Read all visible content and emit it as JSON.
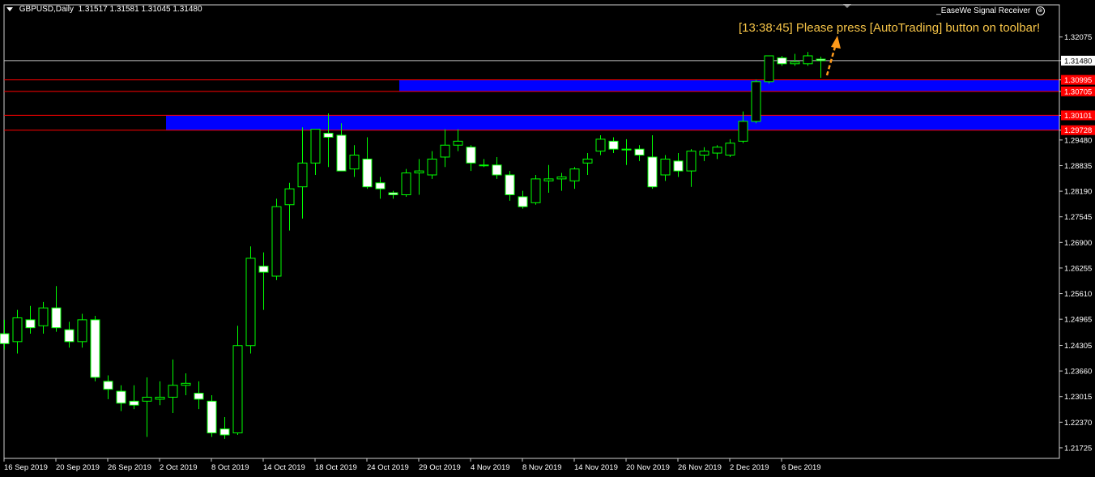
{
  "header": {
    "symbol_label": "GBPUSD,Daily",
    "ohlc_label": "1.31517 1.31581 1.31045 1.31480"
  },
  "indicator": {
    "name": "_EaseWe Signal Receiver",
    "icon": "settings-circle-icon"
  },
  "message": {
    "text": "[13:38:45] Please press [AutoTrading] button on toolbar!"
  },
  "colors": {
    "background": "#000000",
    "candle_border": "#00ff00",
    "bull_body": "#000000",
    "bear_body": "#ffffff",
    "zone_fill": "#0000ff",
    "zone_line": "#ff0000",
    "price_label_red": "#ff0000",
    "bid_line": "#c0c0c0",
    "message": "#f7c548",
    "arrow": "#ff9a1a",
    "axis_text": "#ffffff"
  },
  "chart_data": {
    "type": "candlestick",
    "symbol": "GBPUSD",
    "timeframe": "Daily",
    "ylim": [
      1.2153,
      1.32487
    ],
    "price_ticks": [
      "1.32075",
      "1.31480",
      "1.30995",
      "1.30705",
      "1.30101",
      "1.29728",
      "1.29480",
      "1.28835",
      "1.28190",
      "1.27545",
      "1.26900",
      "1.26255",
      "1.25610",
      "1.24965",
      "1.24305",
      "1.23660",
      "1.23015",
      "1.22370",
      "1.21725"
    ],
    "highlighted_prices": [
      {
        "label": "1.31480",
        "value": 1.3148,
        "style": "current"
      },
      {
        "label": "1.30995",
        "value": 1.30995,
        "style": "red"
      },
      {
        "label": "1.30705",
        "value": 1.30705,
        "style": "red"
      },
      {
        "label": "1.30101",
        "value": 1.30101,
        "style": "red"
      },
      {
        "label": "1.29728",
        "value": 1.29728,
        "style": "red"
      }
    ],
    "x_labels": [
      {
        "label": "16 Sep 2019",
        "index": 0
      },
      {
        "label": "20 Sep 2019",
        "index": 4
      },
      {
        "label": "26 Sep 2019",
        "index": 8
      },
      {
        "label": "2 Oct 2019",
        "index": 12
      },
      {
        "label": "8 Oct 2019",
        "index": 16
      },
      {
        "label": "14 Oct 2019",
        "index": 20
      },
      {
        "label": "18 Oct 2019",
        "index": 24
      },
      {
        "label": "24 Oct 2019",
        "index": 28
      },
      {
        "label": "29 Oct 2019",
        "index": 32
      },
      {
        "label": "4 Nov 2019",
        "index": 36
      },
      {
        "label": "8 Nov 2019",
        "index": 40
      },
      {
        "label": "14 Nov 2019",
        "index": 44
      },
      {
        "label": "20 Nov 2019",
        "index": 48
      },
      {
        "label": "26 Nov 2019",
        "index": 52
      },
      {
        "label": "2 Dec 2019",
        "index": 56
      },
      {
        "label": "6 Dec 2019",
        "index": 60
      }
    ],
    "zones": [
      {
        "top": 1.30995,
        "bottom": 1.30705,
        "start_index": 31
      },
      {
        "top": 1.30101,
        "bottom": 1.29728,
        "start_index": 13
      }
    ],
    "candles": [
      {
        "o": 1.246,
        "h": 1.2495,
        "l": 1.242,
        "c": 1.2435
      },
      {
        "o": 1.244,
        "h": 1.252,
        "l": 1.241,
        "c": 1.25
      },
      {
        "o": 1.2495,
        "h": 1.253,
        "l": 1.246,
        "c": 1.2475
      },
      {
        "o": 1.248,
        "h": 1.254,
        "l": 1.246,
        "c": 1.2525
      },
      {
        "o": 1.2525,
        "h": 1.258,
        "l": 1.2465,
        "c": 1.2475
      },
      {
        "o": 1.247,
        "h": 1.249,
        "l": 1.2425,
        "c": 1.244
      },
      {
        "o": 1.244,
        "h": 1.251,
        "l": 1.2425,
        "c": 1.2495
      },
      {
        "o": 1.2495,
        "h": 1.2505,
        "l": 1.234,
        "c": 1.235
      },
      {
        "o": 1.234,
        "h": 1.2355,
        "l": 1.2295,
        "c": 1.232
      },
      {
        "o": 1.2315,
        "h": 1.233,
        "l": 1.2265,
        "c": 1.2285
      },
      {
        "o": 1.229,
        "h": 1.233,
        "l": 1.227,
        "c": 1.228
      },
      {
        "o": 1.229,
        "h": 1.235,
        "l": 1.22,
        "c": 1.23
      },
      {
        "o": 1.2295,
        "h": 1.234,
        "l": 1.228,
        "c": 1.23
      },
      {
        "o": 1.23,
        "h": 1.2395,
        "l": 1.226,
        "c": 1.233
      },
      {
        "o": 1.233,
        "h": 1.236,
        "l": 1.2305,
        "c": 1.2335
      },
      {
        "o": 1.231,
        "h": 1.234,
        "l": 1.227,
        "c": 1.2295
      },
      {
        "o": 1.229,
        "h": 1.2305,
        "l": 1.22,
        "c": 1.221
      },
      {
        "o": 1.222,
        "h": 1.225,
        "l": 1.2195,
        "c": 1.2205
      },
      {
        "o": 1.221,
        "h": 1.248,
        "l": 1.2205,
        "c": 1.243
      },
      {
        "o": 1.243,
        "h": 1.268,
        "l": 1.241,
        "c": 1.265
      },
      {
        "o": 1.263,
        "h": 1.2665,
        "l": 1.252,
        "c": 1.2615
      },
      {
        "o": 1.2605,
        "h": 1.28,
        "l": 1.2595,
        "c": 1.278
      },
      {
        "o": 1.2785,
        "h": 1.284,
        "l": 1.272,
        "c": 1.2825
      },
      {
        "o": 1.283,
        "h": 1.298,
        "l": 1.275,
        "c": 1.289
      },
      {
        "o": 1.289,
        "h": 1.2975,
        "l": 1.286,
        "c": 1.2975
      },
      {
        "o": 1.2965,
        "h": 1.3015,
        "l": 1.288,
        "c": 1.2955
      },
      {
        "o": 1.296,
        "h": 1.299,
        "l": 1.287,
        "c": 1.287
      },
      {
        "o": 1.2875,
        "h": 1.2935,
        "l": 1.2855,
        "c": 1.291
      },
      {
        "o": 1.29,
        "h": 1.2955,
        "l": 1.2825,
        "c": 1.283
      },
      {
        "o": 1.284,
        "h": 1.2855,
        "l": 1.28,
        "c": 1.2825
      },
      {
        "o": 1.2815,
        "h": 1.282,
        "l": 1.28,
        "c": 1.281
      },
      {
        "o": 1.281,
        "h": 1.2875,
        "l": 1.2805,
        "c": 1.2865
      },
      {
        "o": 1.2865,
        "h": 1.29,
        "l": 1.281,
        "c": 1.287
      },
      {
        "o": 1.286,
        "h": 1.292,
        "l": 1.285,
        "c": 1.29
      },
      {
        "o": 1.2905,
        "h": 1.2975,
        "l": 1.288,
        "c": 1.2935
      },
      {
        "o": 1.2935,
        "h": 1.2975,
        "l": 1.292,
        "c": 1.2945
      },
      {
        "o": 1.293,
        "h": 1.2935,
        "l": 1.287,
        "c": 1.289
      },
      {
        "o": 1.2885,
        "h": 1.29,
        "l": 1.288,
        "c": 1.2885
      },
      {
        "o": 1.2885,
        "h": 1.2905,
        "l": 1.285,
        "c": 1.286
      },
      {
        "o": 1.286,
        "h": 1.287,
        "l": 1.2795,
        "c": 1.281
      },
      {
        "o": 1.2805,
        "h": 1.282,
        "l": 1.2775,
        "c": 1.278
      },
      {
        "o": 1.279,
        "h": 1.286,
        "l": 1.2785,
        "c": 1.285
      },
      {
        "o": 1.2845,
        "h": 1.2885,
        "l": 1.2815,
        "c": 1.285
      },
      {
        "o": 1.285,
        "h": 1.2865,
        "l": 1.282,
        "c": 1.2855
      },
      {
        "o": 1.2845,
        "h": 1.288,
        "l": 1.2825,
        "c": 1.2875
      },
      {
        "o": 1.289,
        "h": 1.2915,
        "l": 1.286,
        "c": 1.29
      },
      {
        "o": 1.292,
        "h": 1.296,
        "l": 1.291,
        "c": 1.295
      },
      {
        "o": 1.2945,
        "h": 1.2955,
        "l": 1.2915,
        "c": 1.2925
      },
      {
        "o": 1.2925,
        "h": 1.295,
        "l": 1.2885,
        "c": 1.2925
      },
      {
        "o": 1.2925,
        "h": 1.2935,
        "l": 1.2895,
        "c": 1.291
      },
      {
        "o": 1.2905,
        "h": 1.296,
        "l": 1.2825,
        "c": 1.283
      },
      {
        "o": 1.286,
        "h": 1.291,
        "l": 1.2845,
        "c": 1.29
      },
      {
        "o": 1.2895,
        "h": 1.2915,
        "l": 1.2855,
        "c": 1.287
      },
      {
        "o": 1.287,
        "h": 1.2925,
        "l": 1.283,
        "c": 1.292
      },
      {
        "o": 1.291,
        "h": 1.293,
        "l": 1.2895,
        "c": 1.292
      },
      {
        "o": 1.2915,
        "h": 1.2935,
        "l": 1.29,
        "c": 1.293
      },
      {
        "o": 1.291,
        "h": 1.295,
        "l": 1.2905,
        "c": 1.294
      },
      {
        "o": 1.2945,
        "h": 1.302,
        "l": 1.294,
        "c": 1.2995
      },
      {
        "o": 1.2995,
        "h": 1.31,
        "l": 1.299,
        "c": 1.3095
      },
      {
        "o": 1.3095,
        "h": 1.316,
        "l": 1.309,
        "c": 1.316
      },
      {
        "o": 1.3155,
        "h": 1.316,
        "l": 1.3135,
        "c": 1.314
      },
      {
        "o": 1.314,
        "h": 1.3165,
        "l": 1.3135,
        "c": 1.3145
      },
      {
        "o": 1.314,
        "h": 1.317,
        "l": 1.3135,
        "c": 1.316
      },
      {
        "o": 1.31517,
        "h": 1.31581,
        "l": 1.31045,
        "c": 1.3148
      }
    ]
  }
}
